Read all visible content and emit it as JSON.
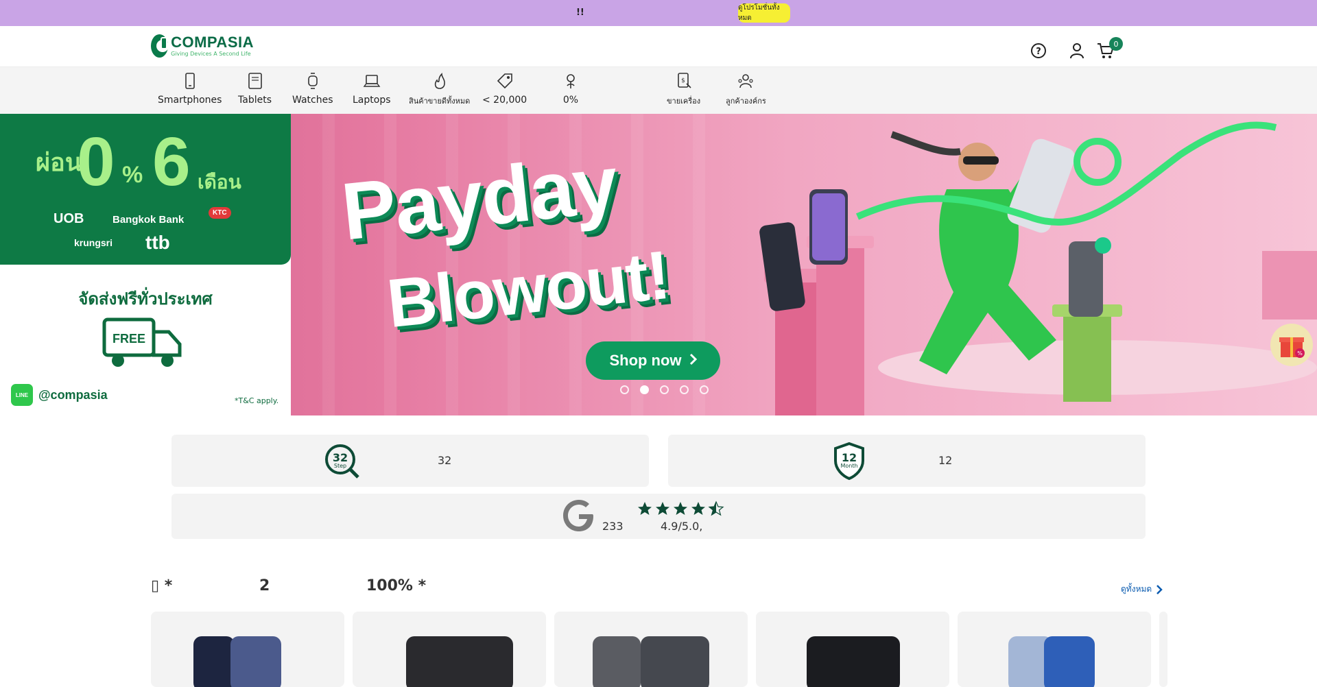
{
  "announcement": {
    "message": "!!",
    "cta_label": "ดูโปรโมชั่นทั้งหมด"
  },
  "header": {
    "logo_name": "COMPASIA",
    "logo_tagline": "Giving Devices A Second Life",
    "cart_count": "0",
    "icons": [
      "help-icon",
      "user-icon",
      "cart-icon"
    ]
  },
  "nav": {
    "categories": [
      {
        "label": "Smartphones",
        "icon": "smartphone-icon"
      },
      {
        "label": "Tablets",
        "icon": "tablet-icon"
      },
      {
        "label": "Watches",
        "icon": "watch-icon"
      },
      {
        "label": "Laptops",
        "icon": "laptop-icon"
      },
      {
        "label": "สินค้าขายดีทั้งหมด",
        "icon": "flame-icon"
      },
      {
        "label": "< 20,000",
        "icon": "price-tag-icon"
      },
      {
        "label": "0%",
        "icon": "installment-icon"
      },
      {
        "label": "ขายเครื่อง",
        "icon": "trade-in-icon"
      },
      {
        "label": "ลูกค้าองค์กร",
        "icon": "business-icon"
      }
    ]
  },
  "hero": {
    "installment_prefix": "ผ่อน",
    "installment_rate": "0",
    "installment_pct": "%",
    "installment_months": "6",
    "installment_unit": "เดือน",
    "banks": [
      "UOB",
      "Bangkok Bank",
      "KTC",
      "krungsri",
      "ttb"
    ],
    "free_shipping": "จัดส่งฟรีทั่วประเทศ",
    "truck_label": "FREE",
    "line_badge": "LINE",
    "line_id": "@compasia",
    "terms": "*T&C apply.",
    "headline_1": "Payday",
    "headline_2": "Blowout!",
    "cta_label": "Shop now",
    "slides": 5,
    "active_slide": 1
  },
  "features": {
    "inspection_badge_number": "32",
    "inspection_badge_sub": "Step",
    "inspection_text": "32",
    "warranty_badge_number": "12",
    "warranty_badge_sub": "Month",
    "warranty_text": "12",
    "review_count": "233",
    "review_rating": "4.9/5.0,",
    "stars": 4.5
  },
  "section": {
    "title_parts": [
      "▯ *",
      "2",
      "100% *"
    ],
    "see_all": "ดูทั้งหมด"
  },
  "colors": {
    "brand_green": "#0a6b46",
    "topbar_purple": "#c9a4e6",
    "cta_yellow": "#f6ef33",
    "link_blue": "#0a5bb0"
  }
}
